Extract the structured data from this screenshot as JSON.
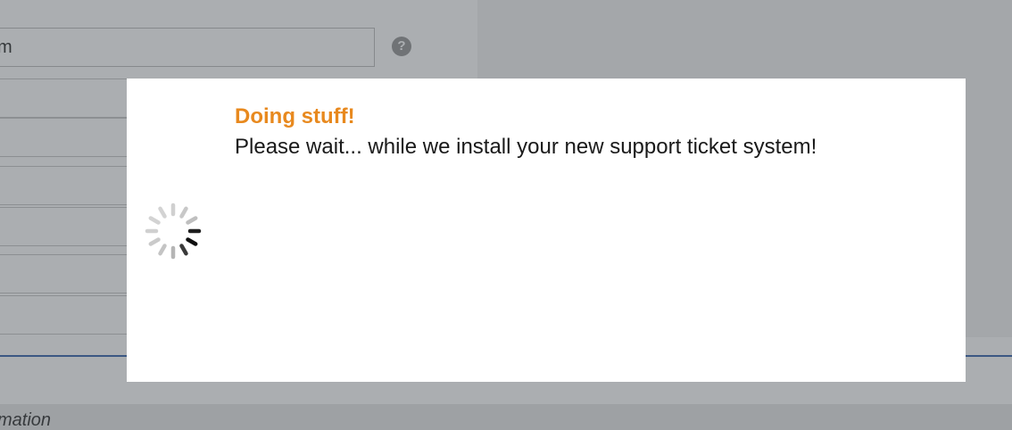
{
  "background": {
    "input_value": "m",
    "help_icon": "question-circle-icon",
    "footer_text": "mation"
  },
  "modal": {
    "title": "Doing stuff!",
    "message": "Please wait... while we install your new support ticket system!",
    "spinner_icon": "loading-spinner-icon",
    "title_color": "#e8891e"
  }
}
